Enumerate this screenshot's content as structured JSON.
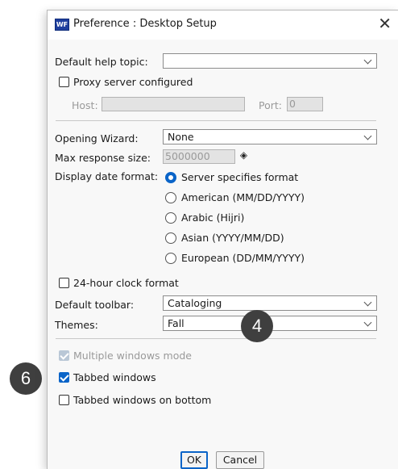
{
  "window": {
    "title": "Preference : Desktop Setup",
    "icon_text": "WF"
  },
  "help": {
    "label": "Default help topic:",
    "value": ""
  },
  "proxy": {
    "checkbox_label": "Proxy server configured",
    "checked": false,
    "host_label": "Host:",
    "host_value": "",
    "port_label": "Port:",
    "port_value": "0"
  },
  "wizard": {
    "label": "Opening Wizard:",
    "value": "None"
  },
  "response": {
    "label": "Max response size:",
    "value": "5000000"
  },
  "date_format": {
    "label": "Display date format:",
    "options": [
      {
        "label": "Server specifies format",
        "selected": true
      },
      {
        "label": "American (MM/DD/YYYY)",
        "selected": false
      },
      {
        "label": "Arabic (Hijri)",
        "selected": false
      },
      {
        "label": "Asian (YYYY/MM/DD)",
        "selected": false
      },
      {
        "label": "European (DD/MM/YYYY)",
        "selected": false
      }
    ]
  },
  "clock": {
    "label": "24-hour clock format",
    "checked": false
  },
  "toolbar": {
    "label": "Default toolbar:",
    "value": "Cataloging"
  },
  "themes": {
    "label": "Themes:",
    "value": "Fall"
  },
  "windows": {
    "multiple": {
      "label": "Multiple windows mode",
      "checked": true,
      "disabled": true
    },
    "tabbed": {
      "label": "Tabbed windows",
      "checked": true
    },
    "tabbed_bottom": {
      "label": "Tabbed windows on bottom",
      "checked": false
    }
  },
  "buttons": {
    "ok": "OK",
    "cancel": "Cancel"
  },
  "callouts": {
    "four": "4",
    "six": "6"
  },
  "colors": {
    "accent": "#0a64c8",
    "badge": "#3f3f3f"
  }
}
